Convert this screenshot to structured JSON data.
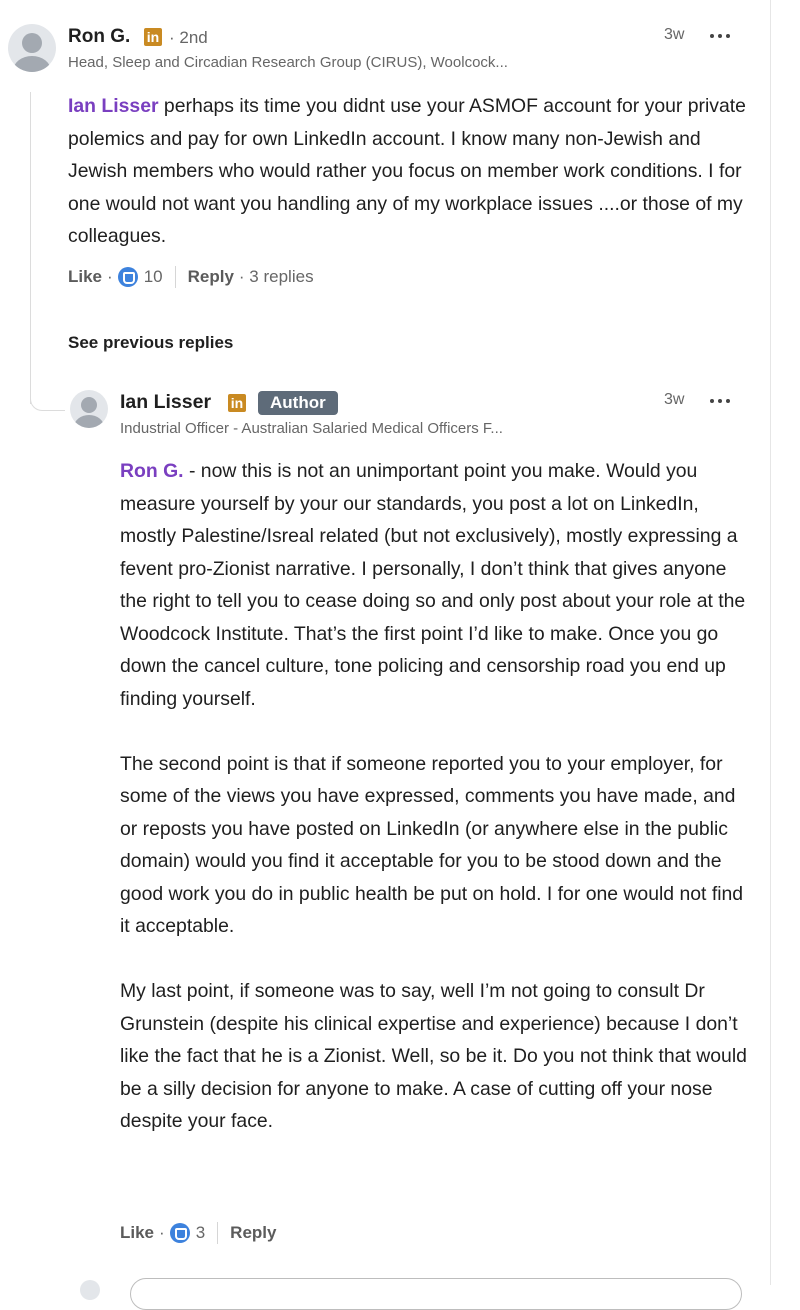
{
  "comment1": {
    "author": "Ron G.",
    "badge": "in",
    "degree": "· 2nd",
    "headline": "Head, Sleep and Circadian Research Group (CIRUS), Woolcock...",
    "time": "3w",
    "mention": "Ian Lisser",
    "text": " perhaps its time you didnt use your ASMOF account for your private polemics and pay for own LinkedIn account. I know many non-Jewish and Jewish members who would rather you focus on member work conditions. I for one would not want you handling any of my workplace issues ....or those of my colleagues.",
    "like_label": "Like",
    "dot": "·",
    "reaction_count": "10",
    "reply_label": "Reply",
    "replies_text": "· 3 replies"
  },
  "see_previous": "See previous replies",
  "reply1": {
    "author": "Ian Lisser",
    "badge": "in",
    "author_badge": "Author",
    "headline": "Industrial Officer - Australian Salaried Medical Officers F...",
    "time": "3w",
    "mention": "Ron G.",
    "para1": " - now this is not an unimportant point you make. Would you measure yourself by your our standards, you post a lot on LinkedIn, mostly Palestine/Isreal related (but not exclusively), mostly expressing a fevent pro-Zionist narrative. I personally, I don’t think that gives anyone the right to tell you to cease doing so and only post about your role at the Woodcock Institute. That’s the first point I’d like to make. Once you go down the cancel culture, tone policing and censorship road you end up finding yourself.",
    "para2": "The second point is that if someone reported you to your employer, for some of the views you have expressed, comments you have made, and or reposts you have posted on LinkedIn (or anywhere else in the public domain) would you find it acceptable for you to be stood down and the good work you do in public health be put on hold. I for one would not find it acceptable.",
    "para3": "My last point, if someone was to say, well I’m not going to consult Dr Grunstein (despite his clinical expertise and experience) because I don’t like the fact that he is a Zionist. Well, so be it. Do you not think that would be a silly decision for anyone to make. A case of cutting off your nose despite your face.",
    "like_label": "Like",
    "dot": "·",
    "reaction_count": "3",
    "reply_label": "Reply"
  },
  "colors": {
    "mention": "#7a3fc0",
    "linkedin_badge": "#c98a22",
    "author_badge": "#5e6b79",
    "reaction": "#3d82dd"
  }
}
